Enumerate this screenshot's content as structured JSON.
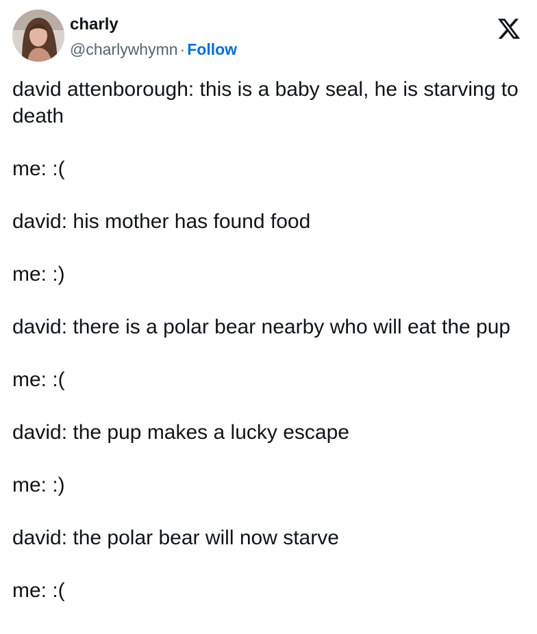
{
  "author": {
    "name": "charly",
    "handle": "@charlywhymn",
    "separator": "·",
    "follow_label": "Follow"
  },
  "brand": {
    "logo_icon": "x-logo-icon",
    "follow_color": "#006fd6"
  },
  "tweet": {
    "paragraphs": [
      "david attenborough: this is a baby seal, he is starving to death",
      "me: :(",
      "david: his mother has found food",
      "me: :)",
      "david: there is a polar bear nearby who will eat the pup",
      "me: :(",
      "david: the pup makes a lucky escape",
      "me: :)",
      "david: the polar bear will now starve",
      "me: :("
    ]
  }
}
